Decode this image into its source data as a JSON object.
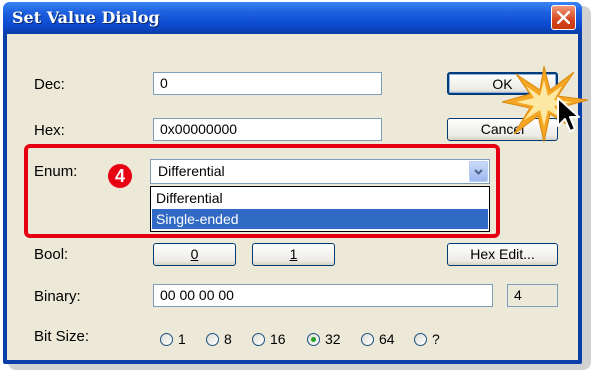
{
  "window": {
    "title": "Set Value Dialog"
  },
  "fields": {
    "dec_label": "Dec:",
    "dec_value": "0",
    "hex_label": "Hex:",
    "hex_value": "0x00000000",
    "enum_label": "Enum:",
    "enum_value": "Differential",
    "enum_options": [
      "Differential",
      "Single-ended"
    ],
    "enum_highlighted": "Single-ended",
    "bool_label": "Bool:",
    "bool_false": "0",
    "bool_true": "1",
    "binary_label": "Binary:",
    "binary_value": "00 00 00 00",
    "binary_count": "4",
    "bitsize_label": "Bit Size:",
    "bitsize_options": [
      "1",
      "8",
      "16",
      "32",
      "64",
      "?"
    ],
    "bitsize_selected": "32"
  },
  "buttons": {
    "ok": "OK",
    "cancel": "Cancel",
    "hex_edit": "Hex Edit..."
  },
  "annotation": {
    "step_number": "4",
    "highlight_color": "#e60012"
  },
  "colors": {
    "titlebar": "#0c4bd0",
    "dialog_bg": "#ece9d8",
    "selection": "#316ac5"
  }
}
